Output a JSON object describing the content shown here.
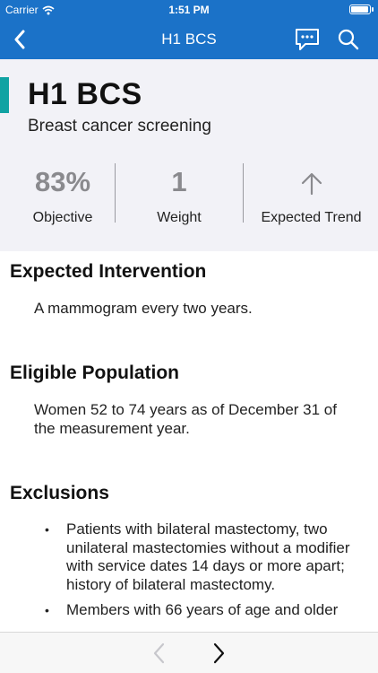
{
  "status_bar": {
    "carrier": "Carrier",
    "time": "1:51 PM",
    "battery_level": 1.0
  },
  "nav": {
    "title": "H1 BCS",
    "back_icon": "chevron-left-icon",
    "chat_icon": "chat-bubble-icon",
    "search_icon": "search-icon"
  },
  "measure": {
    "code": "H1 BCS",
    "name": "Breast cancer screening",
    "accent_color": "#11a3a3",
    "stats": {
      "objective": {
        "value": "83%",
        "label": "Objective"
      },
      "weight": {
        "value": "1",
        "label": "Weight"
      },
      "trend": {
        "icon": "arrow-up-icon",
        "label": "Expected Trend"
      }
    }
  },
  "sections": {
    "intervention": {
      "title": "Expected Intervention",
      "text": "A mammogram every two years."
    },
    "population": {
      "title": "Eligible Population",
      "text": "Women 52 to 74 years as of December 31 of the measurement year."
    },
    "exclusions": {
      "title": "Exclusions",
      "items": [
        "Patients with bilateral mastectomy, two unilateral mastectomies without a modifier with service dates 14 days or more apart; history of bilateral mastectomy.",
        "Members with 66 years of age and older"
      ]
    }
  },
  "toolbar": {
    "prev_icon": "chevron-left-icon",
    "next_icon": "chevron-right-icon"
  },
  "colors": {
    "brand": "#1b72c8",
    "header_bg": "#f2f2f7"
  }
}
